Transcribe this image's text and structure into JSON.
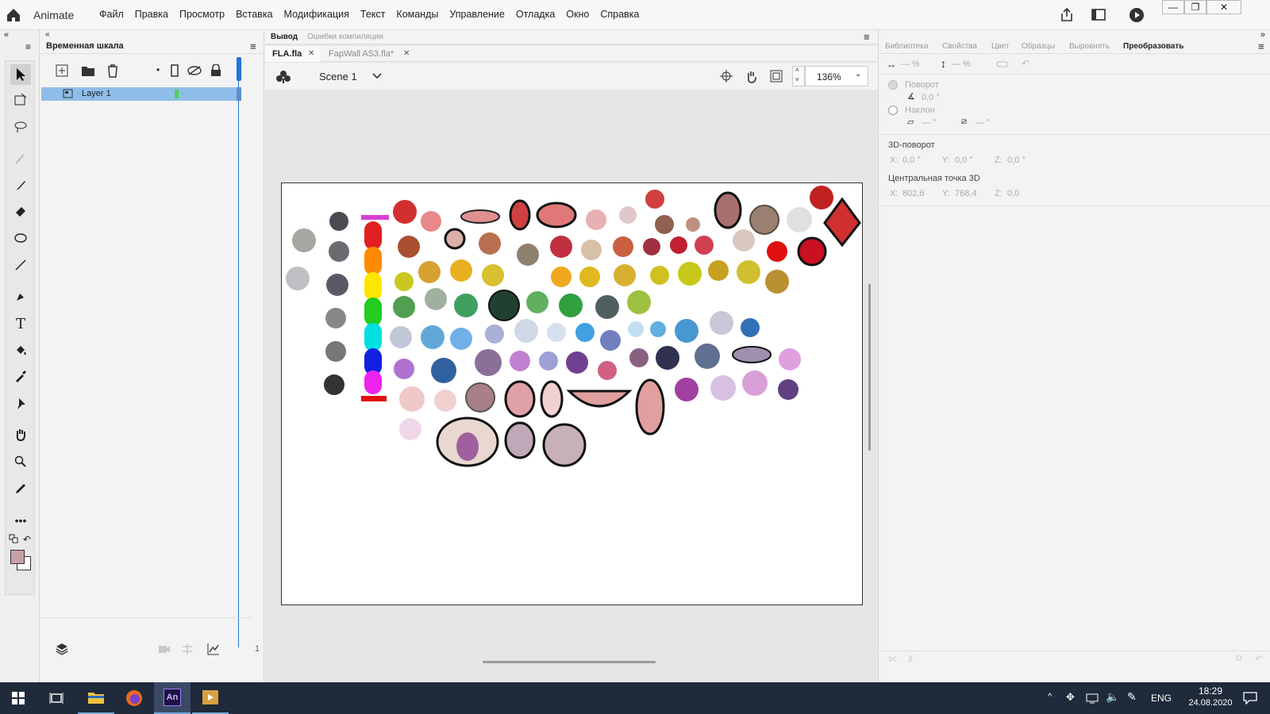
{
  "app": {
    "name": "Animate"
  },
  "menu": [
    "Файл",
    "Правка",
    "Просмотр",
    "Вставка",
    "Модификация",
    "Текст",
    "Команды",
    "Управление",
    "Отладка",
    "Окно",
    "Справка"
  ],
  "timeline": {
    "title": "Временная шкала",
    "layer_name": "Layer 1",
    "frame_number": "1"
  },
  "stage": {
    "output_tab": "Вывод",
    "errors_tab": "Ошибки компиляции",
    "doc_tabs": [
      {
        "label": "FLA.fla",
        "active": true
      },
      {
        "label": "FapWall AS3.fla*",
        "active": false
      }
    ],
    "scene": "Scene 1",
    "zoom": "136%"
  },
  "properties": {
    "tabs": [
      "Библиотека",
      "Свойства",
      "Цвет",
      "Образцы",
      "Выровнять",
      "Преобразовать"
    ],
    "active_tab": "Преобразовать",
    "width_pct": "— %",
    "height_pct": "— %",
    "rotate_label": "Поворот",
    "rotate_value": "0,0 °",
    "skew_label": "Наклон",
    "skew_h": "— °",
    "skew_v": "— °",
    "rot3d_title": "3D-поворот",
    "rot3d": {
      "x_label": "X:",
      "x": "0,0 °",
      "y_label": "Y:",
      "y": "0,0 °",
      "z_label": "Z:",
      "z": "0,0 °"
    },
    "center3d_title": "Центральная точка 3D",
    "center3d": {
      "x_label": "X:",
      "x": "802,6",
      "y_label": "Y:",
      "y": "768,4",
      "z_label": "Z:",
      "z": "0,0"
    }
  },
  "taskbar": {
    "lang": "ENG",
    "time": "18:29",
    "date": "24.08.2020"
  },
  "colors": {
    "accent_blue": "#1f73d6",
    "layer_selected": "#8fbdea",
    "taskbar_bg": "#1f2a3a",
    "fill_swatch": "#c9a0a8"
  }
}
